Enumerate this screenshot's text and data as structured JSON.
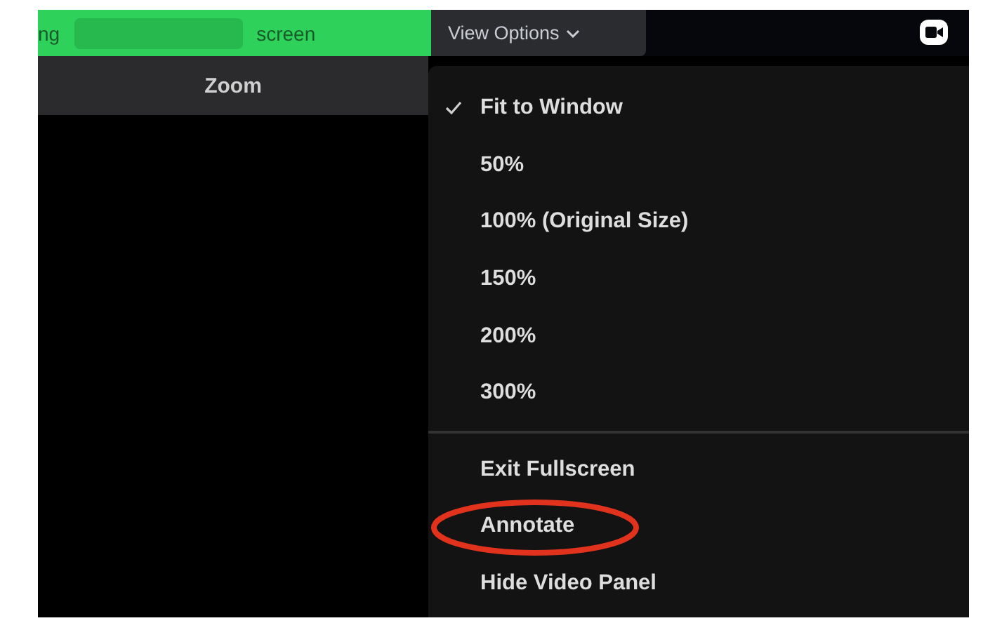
{
  "share_banner": {
    "text_start": "ng",
    "text_end": "screen"
  },
  "view_options": {
    "label": "View Options",
    "expanded": true
  },
  "title_bar": {
    "title": "Zoom"
  },
  "menu": {
    "groups": [
      {
        "items": [
          {
            "label": "Fit to Window",
            "checked": true,
            "circled": false
          },
          {
            "label": "50%",
            "checked": false,
            "circled": false
          },
          {
            "label": "100% (Original Size)",
            "checked": false,
            "circled": false
          },
          {
            "label": "150%",
            "checked": false,
            "circled": false
          },
          {
            "label": "200%",
            "checked": false,
            "circled": false
          },
          {
            "label": "300%",
            "checked": false,
            "circled": false
          }
        ]
      },
      {
        "items": [
          {
            "label": "Exit Fullscreen",
            "checked": false,
            "circled": false
          },
          {
            "label": "Annotate",
            "checked": false,
            "circled": true
          },
          {
            "label": "Hide Video Panel",
            "checked": false,
            "circled": false
          }
        ]
      }
    ]
  }
}
